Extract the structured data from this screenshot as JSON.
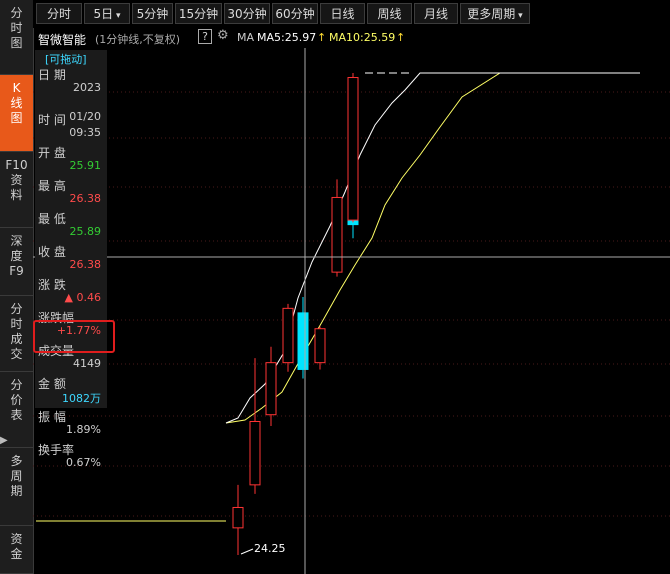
{
  "left_tabs": [
    {
      "label": "分时图",
      "active": false
    },
    {
      "label": "K线图",
      "active": true
    },
    {
      "label": "F10资料",
      "active": false
    },
    {
      "label": "深度F9",
      "active": false
    },
    {
      "label": "分时成交",
      "active": false
    },
    {
      "label": "分价表",
      "active": false
    },
    {
      "label": "多周期",
      "active": false
    },
    {
      "label": "资金",
      "active": false
    }
  ],
  "toolbar": {
    "buttons": [
      "分时",
      "5日",
      "5分钟",
      "15分钟",
      "30分钟",
      "60分钟",
      "日线",
      "周线",
      "月线",
      "更多周期"
    ],
    "dropdown_arrow": "▾"
  },
  "title": {
    "stock_name": "智微智能",
    "period_note": "(1分钟线,不复权)",
    "help_icon": "?",
    "ma_label": "MA",
    "ma5": "MA5:25.97",
    "ma10": "MA10:25.59",
    "arrow": "↑"
  },
  "info_panel": {
    "header": "[可拖动]",
    "rows": [
      {
        "label": "日  期",
        "value": "2023"
      },
      {
        "label": "",
        "value": "01/20"
      },
      {
        "label": "时  间",
        "value": "09:35"
      },
      {
        "label": "开  盘",
        "value": "25.91",
        "color": "#33cc33"
      },
      {
        "label": "最  高",
        "value": "26.38",
        "color": "#ff4b4b"
      },
      {
        "label": "最  低",
        "value": "25.89",
        "color": "#33cc33"
      },
      {
        "label": "收  盘",
        "value": "26.38",
        "color": "#ff4b4b"
      },
      {
        "label": "涨  跌",
        "value": "▲ 0.46",
        "color": "#ff4b4b"
      },
      {
        "label": "涨跌幅",
        "value": "+1.77%",
        "color": "#ff4b4b"
      },
      {
        "label": "成交量",
        "value": "4149"
      },
      {
        "label": "金  额",
        "value": "1082万",
        "color": "#3dd8ff"
      },
      {
        "label": "振  幅",
        "value": "1.89%"
      },
      {
        "label": "换手率",
        "value": "0.67%"
      }
    ]
  },
  "chart_data": {
    "type": "candlestick",
    "low_annotation": "24.25",
    "candles": [
      {
        "open": 24.37,
        "high": 24.56,
        "low": 24.25,
        "close": 24.46
      },
      {
        "open": 24.56,
        "high": 25.12,
        "low": 24.52,
        "close": 24.84
      },
      {
        "open": 24.87,
        "high": 25.17,
        "low": 24.82,
        "close": 25.1
      },
      {
        "open": 25.1,
        "high": 25.36,
        "low": 25.06,
        "close": 25.34
      },
      {
        "open": 25.32,
        "high": 25.39,
        "low": 25.03,
        "close": 25.07
      },
      {
        "open": 25.1,
        "high": 25.26,
        "low": 25.07,
        "close": 25.25
      },
      {
        "open": 25.5,
        "high": 25.91,
        "low": 25.48,
        "close": 25.83
      },
      {
        "open": 25.81,
        "high": 25.92,
        "low": 25.65,
        "close": 25.71
      },
      {
        "open": 25.73,
        "high": 26.38,
        "low": 25.72,
        "close": 26.36
      }
    ],
    "ma5": "MA5:25.97",
    "ma10": "MA10:25.59",
    "colors": {
      "up": "#ff3333",
      "down": "#00e5ff",
      "ma5": "#ffffff",
      "ma10": "#ffff66",
      "crosshair": "#aaaaaa"
    }
  }
}
